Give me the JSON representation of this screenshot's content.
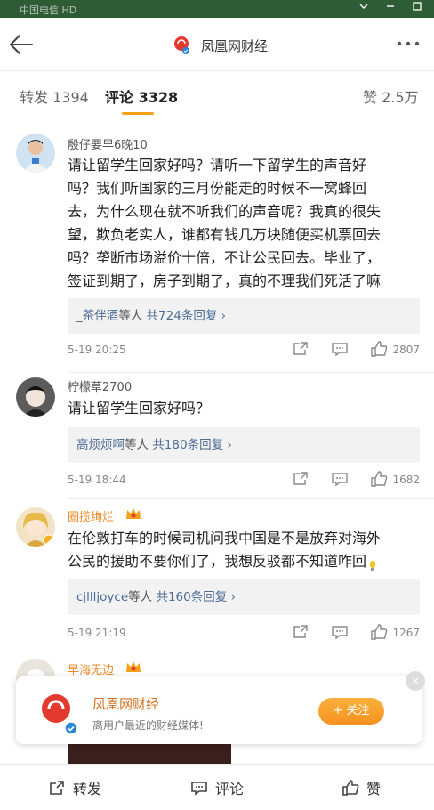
{
  "chrome": {
    "status_text": "中国电信",
    "status_badge": "HD"
  },
  "header": {
    "title": "凤凰网财经",
    "logo_text": "凤凰财经"
  },
  "tabs": [
    {
      "label": "转发",
      "count": "1394"
    },
    {
      "label": "评论",
      "count": "3328"
    },
    {
      "label": "赞",
      "count": "2.5万"
    }
  ],
  "comments": [
    {
      "user": "殷仔要早6晚10",
      "lines": [
        "请让留学生回家好吗？请听一下留学生的声音好",
        "吗？我们听国家的三月份能走的时候不一窝蜂回",
        "去，为什么现在就不听我们的声音呢？我真的很失",
        "望，欺负老实人，谁都有钱几万块随便买机票回去",
        "吗？垄断市场溢价十倍，不让公民回去。毕业了，",
        "签证到期了，房子到期了，真的不理我们死活了嘛"
      ],
      "reply_user": "_茶伴酒",
      "reply_mid": "等人",
      "reply_count": "共724条回复",
      "time": "5-19 20:25",
      "likes": "2807"
    },
    {
      "user": "柠檬草2700",
      "lines": [
        "请让留学生回家好吗？"
      ],
      "reply_user": "高烦烦啊",
      "reply_mid": "等人",
      "reply_count": "共180条回复",
      "time": "5-19 18:44",
      "likes": "1682"
    },
    {
      "user": "圈揽绚烂",
      "lines": [
        "在伦敦打车的时候司机问我中国是不是放弃对海外",
        "公民的援助不要你们了，我想反驳都不知道咋回"
      ],
      "reply_user": "cjllljoyce",
      "reply_mid": "等人",
      "reply_count": "共160条回复",
      "time": "5-19 21:19",
      "likes": "1267"
    },
    {
      "user": "早海无边",
      "lines": []
    }
  ],
  "follow_card": {
    "name": "凤凰网财经",
    "desc": "离用户最近的财经媒体!",
    "button": "+ 关注",
    "logo_text": "凤凰财经"
  },
  "bottombar": {
    "repost": "转发",
    "comment": "评论",
    "like": "赞"
  },
  "colors": {
    "accent": "#f7a11a",
    "link": "#4b6b95",
    "vip_name": "#f08a24"
  }
}
